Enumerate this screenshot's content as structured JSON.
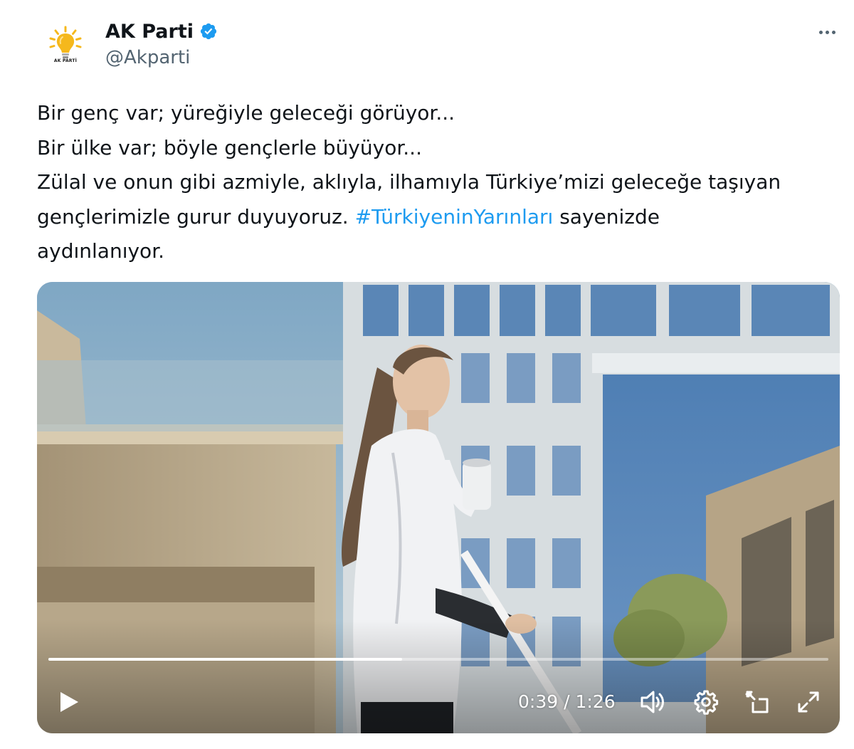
{
  "author": {
    "name": "AK Parti",
    "handle": "@Akparti",
    "logo_text": "AK PARTİ",
    "avatar_icon": "lightbulb-logo-icon",
    "verified_icon": "verified-badge-icon"
  },
  "more_icon": "more-options-icon",
  "tweet": {
    "line1": "Bir genç var; yüreğiyle geleceği görüyor...",
    "line2": "Bir ülke var; böyle gençlerle büyüyor...",
    "line3": "Zülal ve onun gibi azmiyle, aklıyla, ilhamıyla Türkiye’mizi geleceğe taşıyan",
    "line4_before": "gençlerimizle gurur duyuyoruz. ",
    "hashtag": "#TürkiyeninYarınları",
    "line4_after": " sayenizde",
    "line5": "aydınlanıyor."
  },
  "video": {
    "current_time": "0:39",
    "separator": " / ",
    "duration": "1:26",
    "progress": 0.4535,
    "controls": {
      "play": "play-icon",
      "volume": "volume-icon",
      "settings": "settings-gear-icon",
      "pip": "picture-in-picture-icon",
      "fullscreen": "fullscreen-icon"
    }
  },
  "colors": {
    "text": "#0f1419",
    "secondary": "#536471",
    "link": "#1d9bf0",
    "verified": "#1d9bf0",
    "logo_yellow": "#f5b81c"
  }
}
